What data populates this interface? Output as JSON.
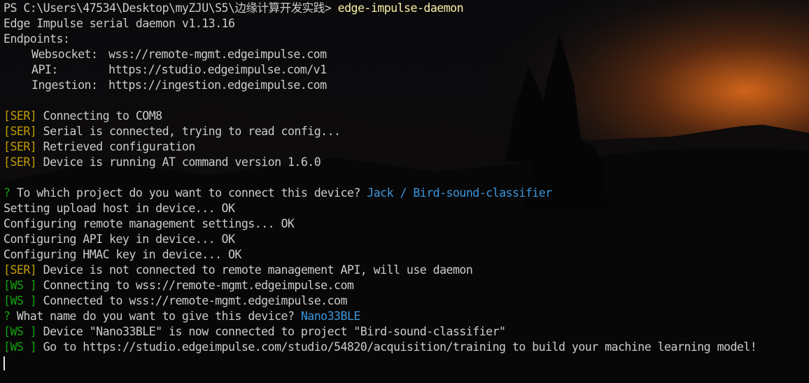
{
  "prompt": {
    "path": "PS C:\\Users\\47534\\Desktop\\myZJU\\S5\\边缘计算开发实践>",
    "command": "edge-impulse-daemon"
  },
  "header": {
    "version_line": "Edge Impulse serial daemon v1.13.16",
    "endpoints_title": "Endpoints:",
    "endpoints": [
      {
        "key": "Websocket:",
        "value": "wss://remote-mgmt.edgeimpulse.com"
      },
      {
        "key": "API:",
        "value": "https://studio.edgeimpulse.com/v1"
      },
      {
        "key": "Ingestion:",
        "value": "https://ingestion.edgeimpulse.com"
      }
    ]
  },
  "tags": {
    "ser": "[SER]",
    "ws": "[WS ]",
    "question": "?"
  },
  "ser_log": [
    "Connecting to COM8",
    "Serial is connected, trying to read config...",
    "Retrieved configuration",
    "Device is running AT command version 1.6.0"
  ],
  "q1": {
    "question": "To which project do you want to connect this device?",
    "answer": "Jack / Bird-sound-classifier"
  },
  "status_lines": [
    "Setting upload host in device... OK",
    "Configuring remote management settings... OK",
    "Configuring API key in device... OK",
    "Configuring HMAC key in device... OK"
  ],
  "ser_remote": "Device is not connected to remote management API, will use daemon",
  "ws_log": [
    "Connecting to wss://remote-mgmt.edgeimpulse.com",
    "Connected to wss://remote-mgmt.edgeimpulse.com"
  ],
  "q2": {
    "question": "What name do you want to give this device?",
    "answer": "Nano33BLE"
  },
  "ws_final": [
    "Device \"Nano33BLE\" is now connected to project \"Bird-sound-classifier\"",
    "Go to https://studio.edgeimpulse.com/studio/54820/acquisition/training to build your machine learning model!"
  ],
  "colors": {
    "text": "#cccccc",
    "ser_tag": "#c19c00",
    "ws_tag": "#13a10e",
    "answer": "#3a96dd",
    "command": "#f9f1a5"
  }
}
